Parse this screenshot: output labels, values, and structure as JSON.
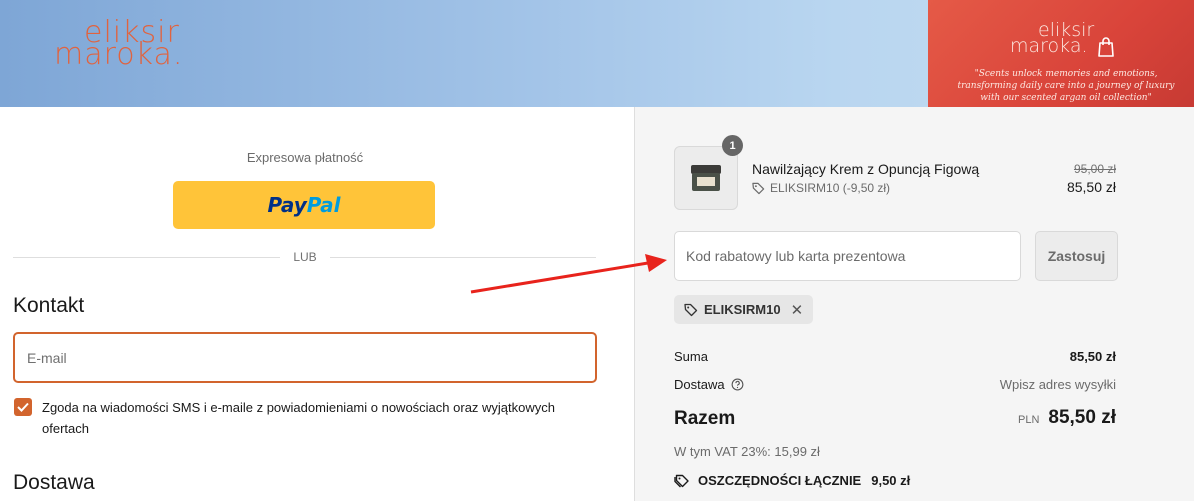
{
  "header": {
    "logo_line1": "eliksir",
    "logo_line2": "maroka.",
    "promo_logo_line1": "eliksir",
    "promo_logo_line2": "maroka.",
    "promo_tagline": "\"Scents unlock memories and emotions, transforming daily care into a journey of luxury with our scented argan oil collection\"",
    "cart_icon": "shopping-bag-icon"
  },
  "express": {
    "label": "Expresowa płatność",
    "paypal_pay": "Pay",
    "paypal_pal": "Pal",
    "or_label": "LUB"
  },
  "contact": {
    "title": "Kontakt",
    "email_placeholder": "E-mail",
    "consent_checked": true,
    "consent_text": "Zgoda na wiadomości SMS i e-maile z powiadomieniami o nowościach oraz wyjątkowych ofertach"
  },
  "delivery": {
    "title": "Dostawa"
  },
  "summary": {
    "item": {
      "quantity": "1",
      "name": "Nawilżający Krem z Opuncją Figową",
      "discount_code": "ELIKSIRM10 (-9,50 zł)",
      "old_price": "95,00 zł",
      "new_price": "85,50 zł"
    },
    "code_placeholder": "Kod rabatowy lub karta prezentowa",
    "apply_label": "Zastosuj",
    "applied_code": "ELIKSIRM10",
    "subtotal_label": "Suma",
    "subtotal_value": "85,50 zł",
    "shipping_label": "Dostawa",
    "shipping_value": "Wpisz adres wysyłki",
    "total_label": "Razem",
    "total_currency": "PLN",
    "total_value": "85,50 zł",
    "vat_line": "W tym VAT 23%: 15,99 zł",
    "savings_label": "OSZCZĘDNOŚCI ŁĄCZNIE",
    "savings_value": "9,50 zł"
  },
  "colors": {
    "accent": "#d2642d",
    "paypal_yellow": "#ffc439",
    "annotation_arrow": "#e8231c"
  }
}
